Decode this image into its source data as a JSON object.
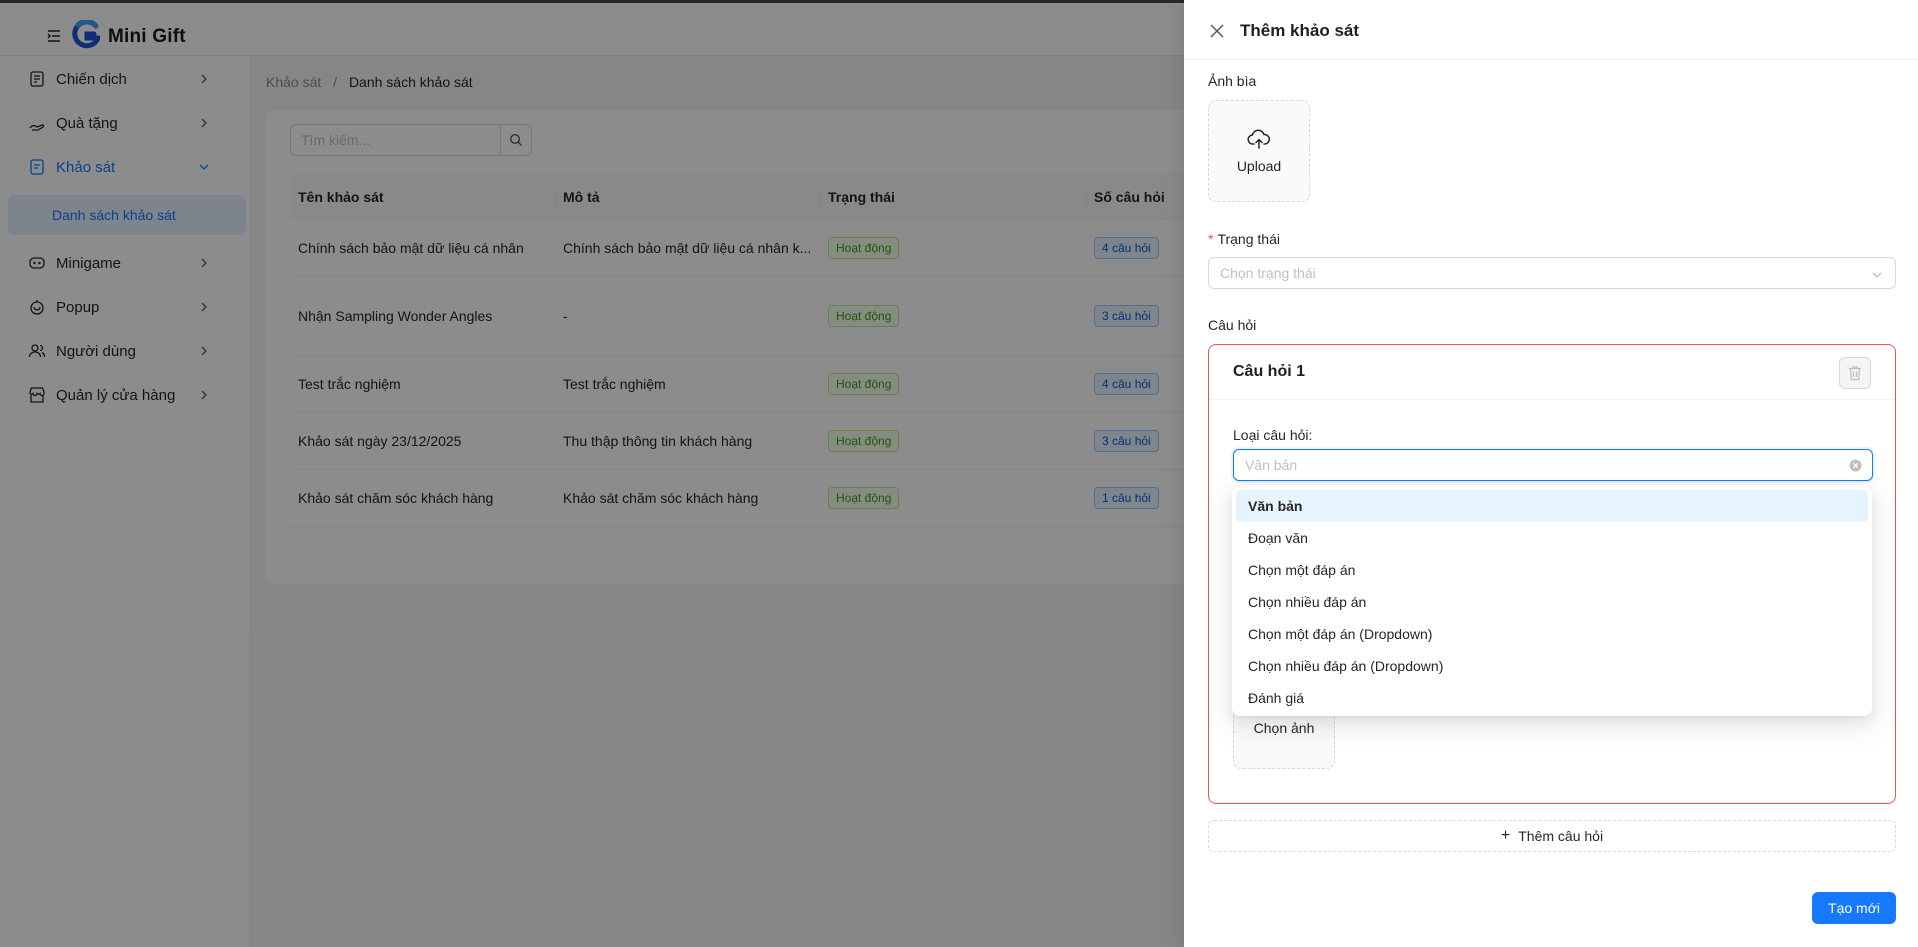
{
  "app": {
    "brand": "Mini Gift"
  },
  "sidebar": {
    "items": [
      {
        "label": "Chiến dịch"
      },
      {
        "label": "Quà tặng"
      },
      {
        "label": "Khảo sát"
      },
      {
        "label": "Minigame"
      },
      {
        "label": "Popup"
      },
      {
        "label": "Người dùng"
      },
      {
        "label": "Quản lý cửa hàng"
      }
    ],
    "sub_active": "Danh sách khảo sát"
  },
  "breadcrumb": {
    "parent": "Khảo sát",
    "separator": "/",
    "current": "Danh sách khảo sát"
  },
  "search": {
    "placeholder": "Tìm kiếm..."
  },
  "table": {
    "columns": [
      "Tên khảo sát",
      "Mô tả",
      "Trạng thái",
      "Số câu hỏi"
    ],
    "rows": [
      {
        "name": "Chính sách bảo mật dữ liệu cá nhân",
        "desc": "Chính sách bảo mật dữ liệu cá nhân k...",
        "status": "Hoạt động",
        "count": "4 câu hỏi"
      },
      {
        "name": "Nhận Sampling Wonder Angles",
        "desc": "-",
        "status": "Hoạt động",
        "count": "3 câu hỏi"
      },
      {
        "name": "Test trắc nghiệm",
        "desc": "Test trắc nghiệm",
        "status": "Hoạt động",
        "count": "4 câu hỏi"
      },
      {
        "name": "Khảo sát ngày 23/12/2025",
        "desc": "Thu thập thông tin khách hàng",
        "status": "Hoạt động",
        "count": "3 câu hỏi"
      },
      {
        "name": "Khảo sát chăm sóc khách hàng",
        "desc": "Khảo sát chăm sóc khách hàng",
        "status": "Hoạt động",
        "count": "1 câu hỏi"
      }
    ]
  },
  "drawer": {
    "title": "Thêm khảo sát",
    "cover_label": "Ảnh bìa",
    "upload_label": "Upload",
    "status_label": "Trạng thái",
    "status_required_mark": "*",
    "status_placeholder": "Chọn trạng thái",
    "questions_label": "Câu hỏi",
    "question": {
      "title": "Câu hỏi 1",
      "type_label": "Loại câu hỏi:",
      "type_value": "Văn bản",
      "image_button": "Chọn ảnh"
    },
    "add_question": "Thêm câu hỏi",
    "add_question_plus": "+",
    "submit": "Tạo mới"
  },
  "dropdown": {
    "options": [
      "Văn bản",
      "Đoạn văn",
      "Chọn một đáp án",
      "Chọn nhiều đáp án",
      "Chọn một đáp án (Dropdown)",
      "Chọn nhiều đáp án (Dropdown)",
      "Đánh giá"
    ],
    "selected_index": 0
  },
  "colors": {
    "primary": "#1677ff",
    "danger": "#ff4d4f",
    "success": "#389e0d",
    "mask": "rgba(0,0,0,0.45)"
  },
  "icons": {
    "menu": "menu-fold-icon",
    "logo": "logo-icon",
    "campaign": "campaign-icon",
    "gift": "gift-icon",
    "survey": "survey-icon",
    "game": "game-icon",
    "popup": "popup-icon",
    "user": "user-icon",
    "store": "store-icon",
    "search": "search-icon",
    "close": "close-icon",
    "upload": "cloud-upload-icon",
    "delete": "trash-icon",
    "clear": "clear-circle-icon",
    "chevron": "chevron-icon"
  }
}
